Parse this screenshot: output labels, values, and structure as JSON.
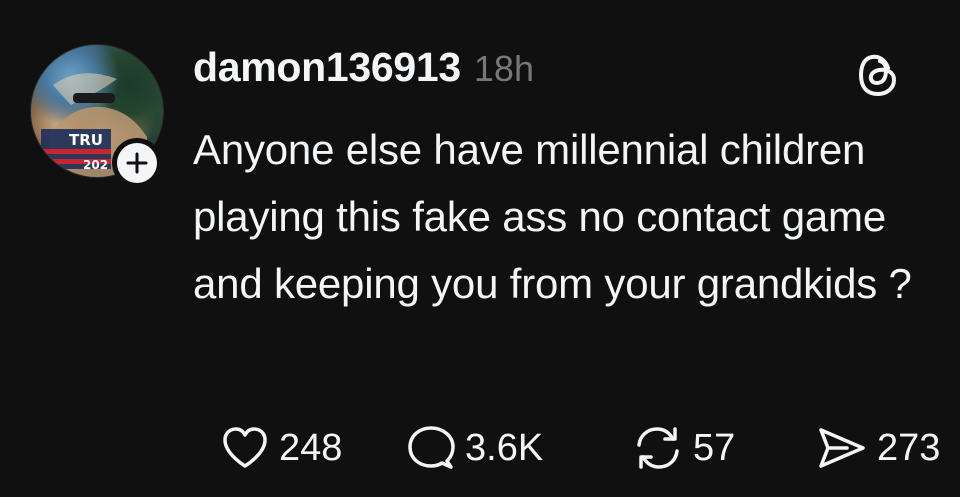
{
  "post": {
    "username": "damon136913",
    "timestamp": "18h",
    "text": "Anyone else have millennial children playing this fake ass no contact game and keeping you from your grandkids ?",
    "avatar_icon": "profile-avatar-icon",
    "follow_icon": "plus-icon",
    "app_icon": "threads-logo-icon"
  },
  "actions": {
    "likes": "248",
    "replies": "3.6K",
    "reposts": "57",
    "shares": "273",
    "like_icon": "heart-icon",
    "reply_icon": "speech-bubble-icon",
    "repost_icon": "repost-icon",
    "share_icon": "send-icon"
  },
  "colors": {
    "background": "#101010",
    "text_primary": "#f3f5f7",
    "text_secondary": "#777777"
  }
}
